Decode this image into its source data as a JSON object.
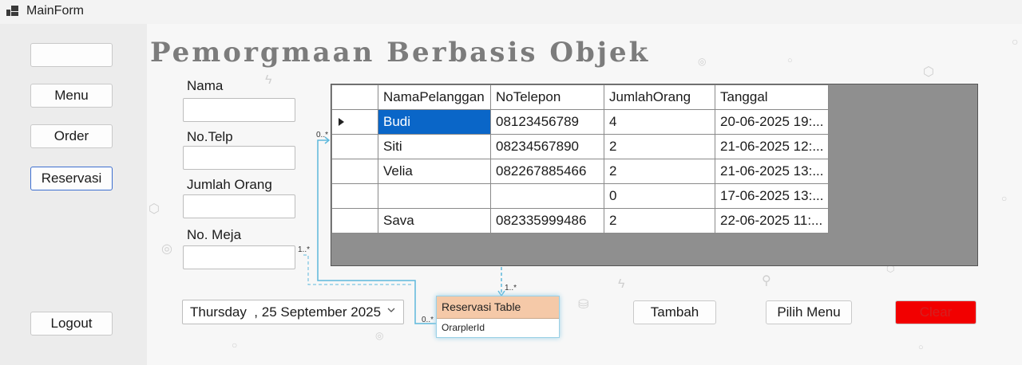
{
  "window": {
    "title": "MainForm"
  },
  "sidebar": {
    "buttons": [
      {
        "label": ""
      },
      {
        "label": "Menu"
      },
      {
        "label": "Order"
      },
      {
        "label": "Reservasi"
      },
      {
        "label": "Logout"
      }
    ]
  },
  "header": {
    "title": "Pemorgmaan Berbasis Objek"
  },
  "form": {
    "nama_label": "Nama",
    "telp_label": "No.Telp",
    "jumlah_label": "Jumlah Orang",
    "meja_label": "No. Meja",
    "nama_value": "",
    "telp_value": "",
    "jumlah_value": "",
    "meja_value": "",
    "date_value": "Thursday  , 25 September 2025"
  },
  "grid": {
    "columns": [
      "NamaPelanggan",
      "NoTelepon",
      "JumlahOrang",
      "Tanggal"
    ],
    "rows": [
      [
        "Budi",
        "08123456789",
        "4",
        "20-06-2025 19:..."
      ],
      [
        "Siti",
        "08234567890",
        "2",
        "21-06-2025 12:..."
      ],
      [
        "Velia",
        "082267885466",
        "2",
        "21-06-2025 13:..."
      ],
      [
        "",
        "",
        "0",
        "17-06-2025 13:..."
      ],
      [
        "Sava",
        "082335999486",
        "2",
        "22-06-2025 11:..."
      ]
    ],
    "selected_row": 0
  },
  "diagram": {
    "entity_title": "Reservasi Table",
    "entity_field": "OrarplerId",
    "mult_left_top": "0..*",
    "mult_left_mid": "1..*",
    "mult_entity_left": "0..*",
    "mult_top": "1..*"
  },
  "actions": {
    "tambah_label": "Tambah",
    "pilih_menu_label": "Pilih Menu",
    "clear_label": "Clear"
  },
  "colors": {
    "selection": "#0a66c8",
    "clear_button": "#f20000",
    "entity_header": "#f5c9a8",
    "connector": "#5fb9dc"
  }
}
